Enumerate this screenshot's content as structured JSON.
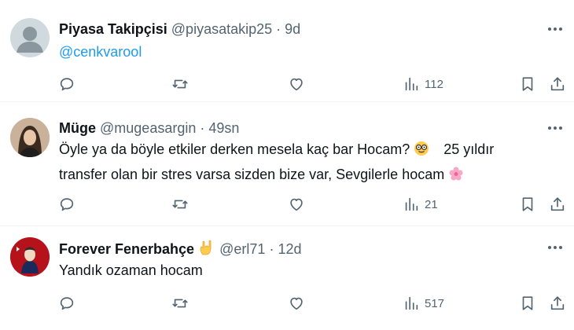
{
  "tweets": [
    {
      "name": "Piyasa Takipçisi",
      "handle": "@piyasatakip25",
      "sep": "·",
      "time": "9d",
      "text": "@cenkvarool",
      "views": "112"
    },
    {
      "name": "Müge",
      "handle": "@mugeasargin",
      "sep": "·",
      "time": "49sn",
      "text1": "Öyle ya da böyle etkiler derken mesela kaç bar Hocam?",
      "text2": "25 yıldır",
      "text3": "transfer olan bir stres varsa sizden bize var, Sevgilerle hocam",
      "views": "21"
    },
    {
      "name": "Forever Fenerbahçe",
      "handle": "@erl71",
      "sep": "·",
      "time": "12d",
      "text": "Yandık ozaman hocam",
      "views": "517"
    }
  ],
  "icons": {
    "reply": "reply-icon",
    "retweet": "retweet-icon",
    "like": "heart-icon",
    "views": "views-icon",
    "bookmark": "bookmark-icon",
    "share": "share-icon",
    "more": "more-icon"
  },
  "colors": {
    "text": "#0f1419",
    "secondary": "#536471",
    "link": "#1d9bf0",
    "divider": "#eff3f4"
  }
}
